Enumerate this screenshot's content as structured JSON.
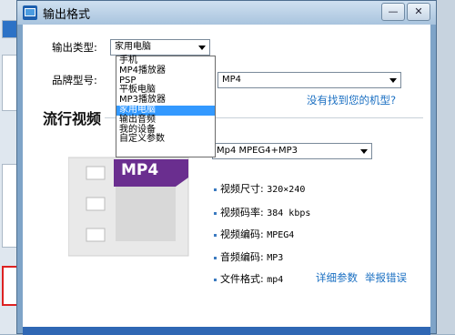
{
  "window": {
    "title": "输出格式",
    "minimize": "—",
    "close": "✕"
  },
  "form": {
    "type_label": "输出类型:",
    "type_value": "家用电脑",
    "brand_label": "品牌型号:",
    "brand_value": "MP4",
    "missing_model_link": "没有找到您的机型?",
    "section_title": "流行视频",
    "format_value": "Mp4 MPEG4+MP3"
  },
  "dropdown": {
    "options": [
      "手机",
      "MP4播放器",
      "PSP",
      "平板电脑",
      "MP3播放器",
      "家用电脑",
      "输出音频",
      "我的设备",
      "自定义参数"
    ],
    "selected_index": 5
  },
  "thumbnail": {
    "badge": "MP4"
  },
  "props": [
    {
      "label": "视频尺寸:",
      "value": "320×240"
    },
    {
      "label": "视频码率:",
      "value": "384 kbps"
    },
    {
      "label": "视频编码:",
      "value": "MPEG4"
    },
    {
      "label": "音频编码:",
      "value": "MP3"
    },
    {
      "label": "文件格式:",
      "value": "mp4"
    }
  ],
  "links": {
    "details": "详细参数",
    "report": "举报错误"
  },
  "colors": {
    "accent": "#1a6fc2",
    "badge": "#6a2e8f",
    "selection": "#3399ff"
  }
}
